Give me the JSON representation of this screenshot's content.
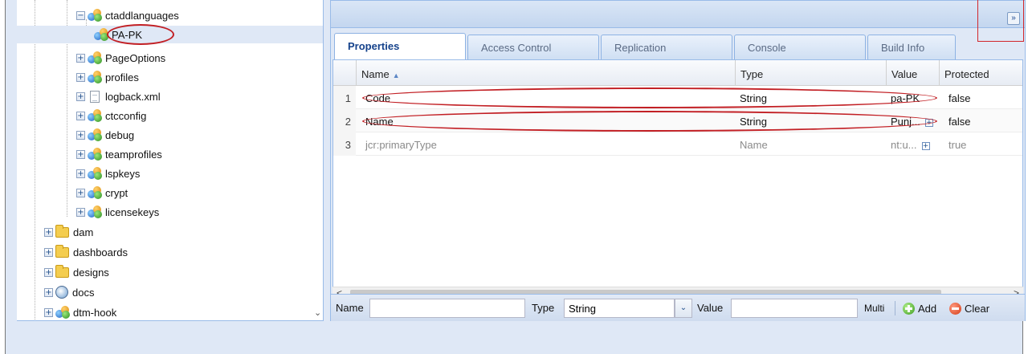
{
  "tree": {
    "items": [
      {
        "label": "ctaddlanguages",
        "icon": "node-icon",
        "toggle": "−"
      },
      {
        "label": "PA-PK",
        "icon": "node-icon",
        "toggle": ""
      },
      {
        "label": "PageOptions",
        "icon": "node-icon",
        "toggle": "+"
      },
      {
        "label": "profiles",
        "icon": "node-icon",
        "toggle": "+"
      },
      {
        "label": "logback.xml",
        "icon": "file-icon",
        "toggle": "+"
      },
      {
        "label": "ctcconfig",
        "icon": "node-icon",
        "toggle": "+"
      },
      {
        "label": "debug",
        "icon": "node-icon",
        "toggle": "+"
      },
      {
        "label": "teamprofiles",
        "icon": "node-icon",
        "toggle": "+"
      },
      {
        "label": "lspkeys",
        "icon": "node-icon",
        "toggle": "+"
      },
      {
        "label": "crypt",
        "icon": "node-icon",
        "toggle": "+"
      },
      {
        "label": "licensekeys",
        "icon": "node-icon",
        "toggle": "+"
      },
      {
        "label": "dam",
        "icon": "folder-icon",
        "toggle": "+"
      },
      {
        "label": "dashboards",
        "icon": "folder-icon",
        "toggle": "+"
      },
      {
        "label": "designs",
        "icon": "folder-icon",
        "toggle": "+"
      },
      {
        "label": "docs",
        "icon": "globe-icon",
        "toggle": "+"
      },
      {
        "label": "dtm-hook",
        "icon": "node-icon",
        "toggle": "+"
      }
    ],
    "scroll_chevron": "⌄"
  },
  "topbar": {
    "expand_glyph": "»"
  },
  "tabs": [
    {
      "label": "Properties",
      "active": true
    },
    {
      "label": "Access Control",
      "active": false
    },
    {
      "label": "Replication",
      "active": false
    },
    {
      "label": "Console",
      "active": false
    },
    {
      "label": "Build Info",
      "active": false
    }
  ],
  "grid": {
    "columns": [
      "Name",
      "Type",
      "Value",
      "Protected"
    ],
    "sort_indicator": "▲",
    "rows": [
      {
        "num": "1",
        "name": "Code",
        "type": "String",
        "value": "pa-PK",
        "protected": "false",
        "expand": ""
      },
      {
        "num": "2",
        "name": "Name",
        "type": "String",
        "value": "Punj...",
        "protected": "false",
        "expand": "+"
      },
      {
        "num": "3",
        "name": "jcr:primaryType",
        "type": "Name",
        "value": "nt:u...",
        "protected": "true",
        "expand": "+"
      }
    ]
  },
  "scrollbar": {
    "left_arrow": "<",
    "right_arrow": ">"
  },
  "toolbar": {
    "name_label": "Name",
    "name_value": "",
    "type_label": "Type",
    "type_value": "String",
    "type_trigger": "⌄",
    "value_label": "Value",
    "value_value": "",
    "multi_label": "Multi",
    "add_label": "Add",
    "clear_label": "Clear"
  },
  "colors": {
    "accent": "#15428b",
    "annotation": "#c21f24",
    "panel": "#dfe8f6"
  }
}
